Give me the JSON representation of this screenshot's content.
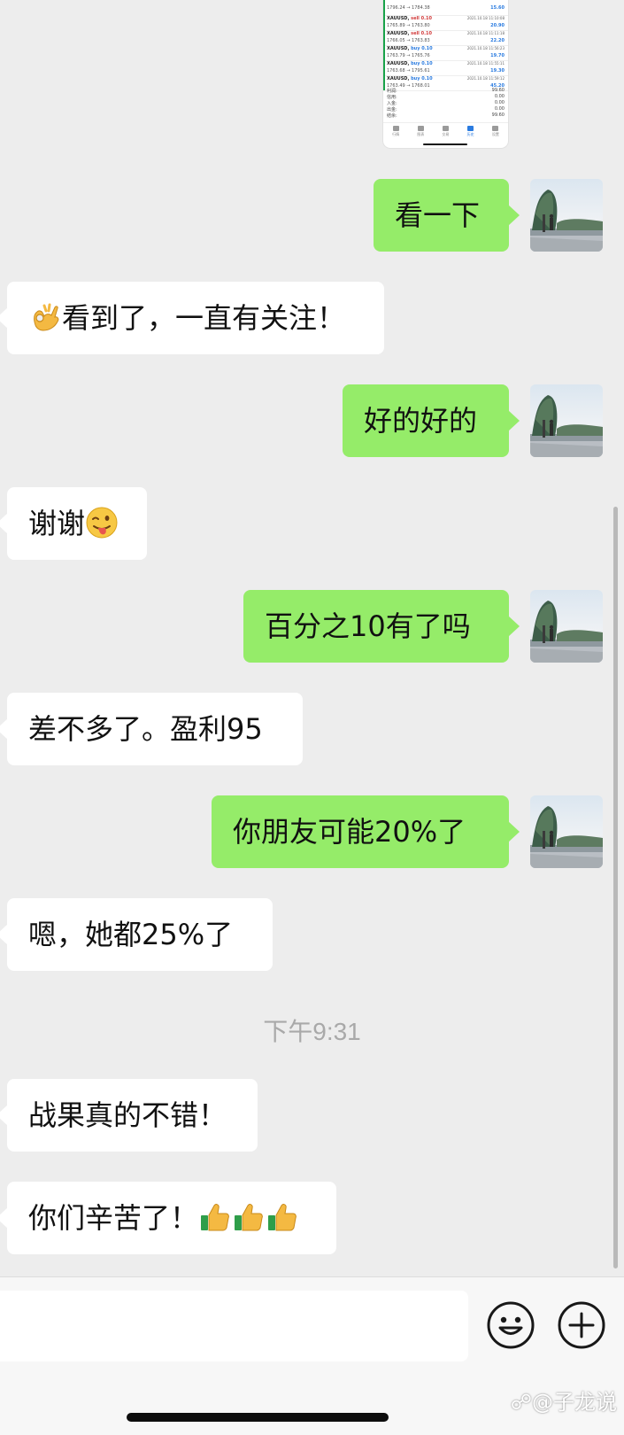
{
  "shared_screenshot": {
    "rows": [
      {
        "symbol": "",
        "side": "",
        "price": "1796.24 → 1784.38",
        "date": "",
        "pnl": "15.60"
      },
      {
        "symbol": "XAUUSD,",
        "side": "sell 0.10",
        "price": "1765.89 → 1763.80",
        "date": "2021.10.18 11:10:08",
        "pnl": "20.90"
      },
      {
        "symbol": "XAUUSD,",
        "side": "sell 0.10",
        "price": "1766.05 → 1763.83",
        "date": "2021.10.18 11:11:18",
        "pnl": "22.20"
      },
      {
        "symbol": "XAUUSD,",
        "side": "buy 0.10",
        "price": "1763.79 → 1765.76",
        "date": "2021.10.18 11:56:23",
        "pnl": "19.70"
      },
      {
        "symbol": "XAUUSD,",
        "side": "buy 0.10",
        "price": "1763.68 → 1795.61",
        "date": "2021.10.18 11:55:11",
        "pnl": "19.30"
      },
      {
        "symbol": "XAUUSD,",
        "side": "buy 0.10",
        "price": "1763.49 → 1768.01",
        "date": "2021.10.18 11:59:12",
        "pnl": "45.20"
      }
    ],
    "summary": [
      {
        "label": "利润:",
        "value": "99.60"
      },
      {
        "label": "信用:",
        "value": "0.00"
      },
      {
        "label": "入金:",
        "value": "0.00"
      },
      {
        "label": "出金:",
        "value": "0.00"
      },
      {
        "label": "结余:",
        "value": "99.60"
      }
    ],
    "tabs": [
      {
        "label": "行情",
        "active": false
      },
      {
        "label": "图表",
        "active": false
      },
      {
        "label": "交易",
        "active": false
      },
      {
        "label": "历史",
        "active": true
      },
      {
        "label": "设置",
        "active": false
      }
    ]
  },
  "messages": [
    {
      "from": "me",
      "text": "看一下"
    },
    {
      "from": "them",
      "emoji_before": "ok-hand-emoji",
      "text": "看到了，一直有关注！"
    },
    {
      "from": "me",
      "text": "好的好的"
    },
    {
      "from": "them",
      "text": "谢谢",
      "emoji_after": "winking-tongue-emoji"
    },
    {
      "from": "me",
      "text": "百分之10有了吗"
    },
    {
      "from": "them",
      "text": "差不多了。盈利95"
    },
    {
      "from": "me",
      "text": "你朋友可能20%了"
    },
    {
      "from": "them",
      "text": "嗯，她都25%了"
    },
    {
      "from": "them",
      "text": "战果真的不错！"
    },
    {
      "from": "them",
      "text": "你们辛苦了！",
      "emoji_after": "thumbs-up-emoji ×3"
    }
  ],
  "timestamp": "下午9:31",
  "input_bar": {
    "placeholder": "",
    "emoji_button_icon": "smiley-face-icon",
    "more_button_icon": "plus-circle-icon"
  },
  "watermark": "@子龙说",
  "colors": {
    "chat_background": "#ededed",
    "my_bubble": "#95ec69",
    "their_bubble": "#ffffff",
    "timestamp_text": "#a9a9a9",
    "input_bar_background": "#f7f7f7"
  }
}
